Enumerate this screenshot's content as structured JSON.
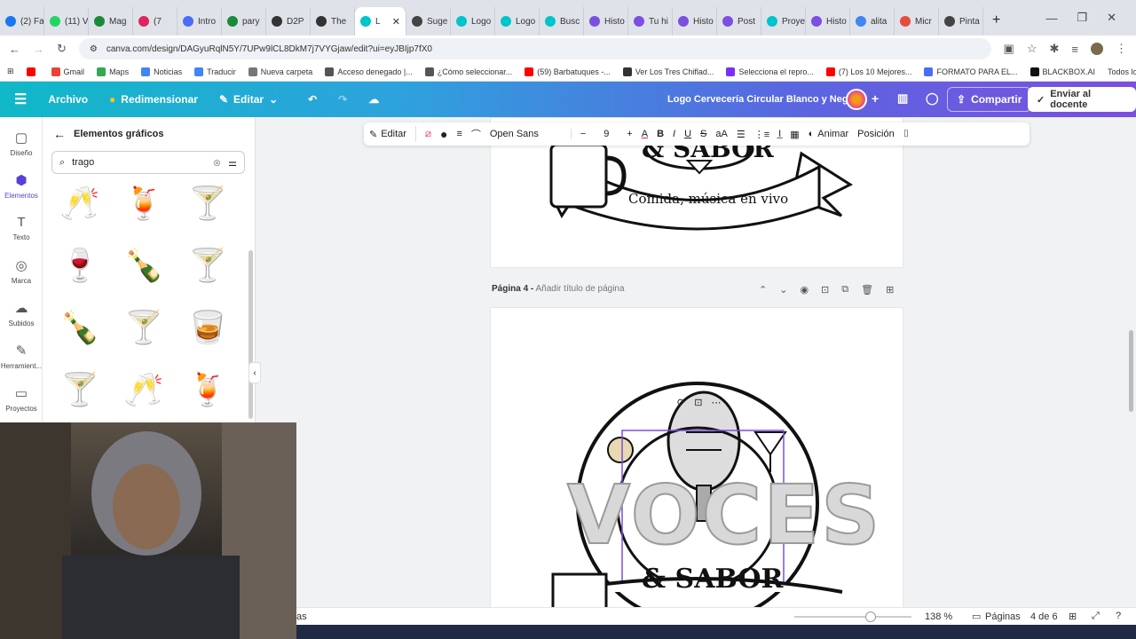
{
  "browser": {
    "tabs": [
      {
        "label": "(2) Fa",
        "color": "#1877f2"
      },
      {
        "label": "(11) V",
        "color": "#25d366"
      },
      {
        "label": "Mag",
        "color": "#1a8a3a"
      },
      {
        "label": "(7",
        "color": "#e0245e"
      },
      {
        "label": "Intro",
        "color": "#4a6cf7"
      },
      {
        "label": "pary",
        "color": "#1a8a3a"
      },
      {
        "label": "D2P",
        "color": "#333"
      },
      {
        "label": "The",
        "color": "#333"
      },
      {
        "label": "L",
        "color": "#00c4cc",
        "active": true
      },
      {
        "label": "Suge",
        "color": "#444"
      },
      {
        "label": "Logo",
        "color": "#00c4cc"
      },
      {
        "label": "Logo",
        "color": "#00c4cc"
      },
      {
        "label": "Busc",
        "color": "#00c4cc"
      },
      {
        "label": "Histo",
        "color": "#7b4fe0"
      },
      {
        "label": "Tu hi",
        "color": "#7b4fe0"
      },
      {
        "label": "Histo",
        "color": "#7b4fe0"
      },
      {
        "label": "Post",
        "color": "#7b4fe0"
      },
      {
        "label": "Proye",
        "color": "#00c4cc"
      },
      {
        "label": "Histo",
        "color": "#7b4fe0"
      },
      {
        "label": "alita",
        "color": "#4285f4"
      },
      {
        "label": "Micr",
        "color": "#e74c3c"
      },
      {
        "label": "Pinta",
        "color": "#444"
      }
    ],
    "url": "canva.com/design/DAGyuRqlN5Y/7UPw9lCL8DkM7j7VYGjaw/edit?ui=eyJBIjp7fX0",
    "bookmarks": [
      {
        "label": "",
        "color": "#ff0000"
      },
      {
        "label": "Gmail",
        "color": "#ea4335"
      },
      {
        "label": "Maps",
        "color": "#34a853"
      },
      {
        "label": "Noticias",
        "color": "#4285f4"
      },
      {
        "label": "Traducir",
        "color": "#4285f4"
      },
      {
        "label": "Nueva carpeta",
        "color": "#777"
      },
      {
        "label": "Acceso denegado |...",
        "color": "#555"
      },
      {
        "label": "¿Cómo seleccionar...",
        "color": "#555"
      },
      {
        "label": "(59) Barbatuques -...",
        "color": "#ff0000"
      },
      {
        "label": "Ver Los Tres Chiflad...",
        "color": "#333"
      },
      {
        "label": "Selecciona el repro...",
        "color": "#7b2ff7"
      },
      {
        "label": "(7) Los 10 Mejores...",
        "color": "#ff0000"
      },
      {
        "label": "FORMATO PARA EL...",
        "color": "#4a6cf7"
      },
      {
        "label": "BLACKBOX.AI",
        "color": "#111"
      }
    ],
    "all_bookmarks": "Todos los marcadores"
  },
  "header": {
    "file": "Archivo",
    "resize": "Redimensionar",
    "edit": "Editar",
    "title": "Logo Cervecería Circular Blanco y Negro",
    "share": "Compartir",
    "send": "Enviar al docente"
  },
  "rail": [
    {
      "label": "Diseño",
      "icon": "▢"
    },
    {
      "label": "Elementos",
      "icon": "⬢"
    },
    {
      "label": "Texto",
      "icon": "T"
    },
    {
      "label": "Marca",
      "icon": "◎"
    },
    {
      "label": "Subidos",
      "icon": "☁"
    },
    {
      "label": "Herramient...",
      "icon": "✎"
    },
    {
      "label": "Proyectos",
      "icon": "▭"
    }
  ],
  "panel": {
    "title": "Elementos gráficos",
    "search_value": "trago",
    "thumbs": [
      "two glasses sketch",
      "orange cocktail",
      "pink cocktail",
      "red martini",
      "two bottles cheers",
      "pink martini",
      "champagne bottle",
      "pink coupe",
      "lemon glass",
      "martini outline",
      "glasses cheers",
      "margarita"
    ]
  },
  "toolbar": {
    "edit": "Editar",
    "font": "Open Sans",
    "size": "9",
    "animate": "Animar",
    "position": "Posición"
  },
  "page_top": {
    "subtitle": "Comida, música en vivo",
    "sabor": "& SABOR"
  },
  "page4": {
    "label": "Página 4 -",
    "placeholder": "Añadir título de página",
    "voces": "VOCES",
    "sabor": "& SABOR"
  },
  "status": {
    "notes": "as",
    "zoom": "138 %",
    "pages_label": "Páginas",
    "pages_count": "4 de 6"
  }
}
